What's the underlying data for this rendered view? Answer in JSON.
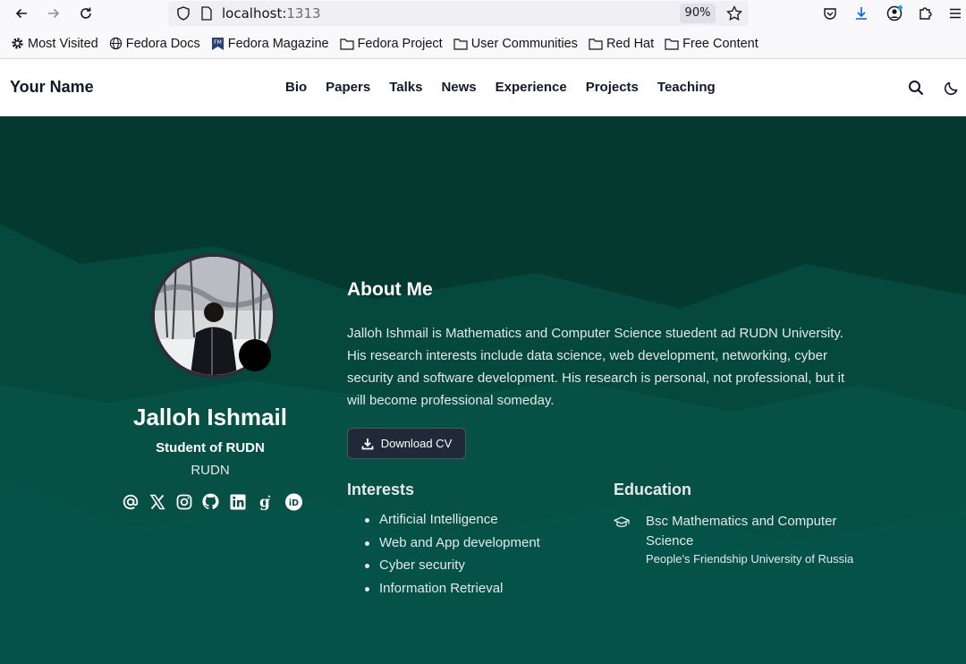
{
  "browser": {
    "url_host": "localhost:",
    "url_port": "1313",
    "zoom": "90%"
  },
  "bookmarks": [
    {
      "label": "Most Visited",
      "icon": "gear-icon"
    },
    {
      "label": "Fedora Docs",
      "icon": "globe-icon"
    },
    {
      "label": "Fedora Magazine",
      "icon": "fedora-magazine-icon"
    },
    {
      "label": "Fedora Project",
      "icon": "folder-icon"
    },
    {
      "label": "User Communities",
      "icon": "folder-icon"
    },
    {
      "label": "Red Hat",
      "icon": "folder-icon"
    },
    {
      "label": "Free Content",
      "icon": "folder-icon"
    }
  ],
  "nav": {
    "brand": "Your Name",
    "links": [
      "Bio",
      "Papers",
      "Talks",
      "News",
      "Experience",
      "Projects",
      "Teaching"
    ]
  },
  "profile": {
    "name": "Jalloh Ishmail",
    "role": "Student of RUDN",
    "organization": "RUDN",
    "socials": [
      "email-icon",
      "x-icon",
      "instagram-icon",
      "github-icon",
      "linkedin-icon",
      "google-scholar-icon",
      "orcid-icon"
    ]
  },
  "about": {
    "title": "About Me",
    "text": "Jalloh Ishmail is Mathematics and Computer Science stuedent ad RUDN University. His research interests include data science, web development, networking, cyber security and software development. His research is personal, not professional, but it will become professional someday.",
    "cv_label": "Download CV"
  },
  "interests": {
    "title": "Interests",
    "items": [
      "Artificial Intelligence",
      "Web and App development",
      "Cyber security",
      "Information Retrieval"
    ]
  },
  "education": {
    "title": "Education",
    "degree": "Bsc Mathematics and Computer Science",
    "institution": "People's Friendship University of Russia"
  },
  "colors": {
    "hero_bg": "#065046",
    "hero_dark": "#04392f",
    "button_bg": "#1f2937"
  }
}
